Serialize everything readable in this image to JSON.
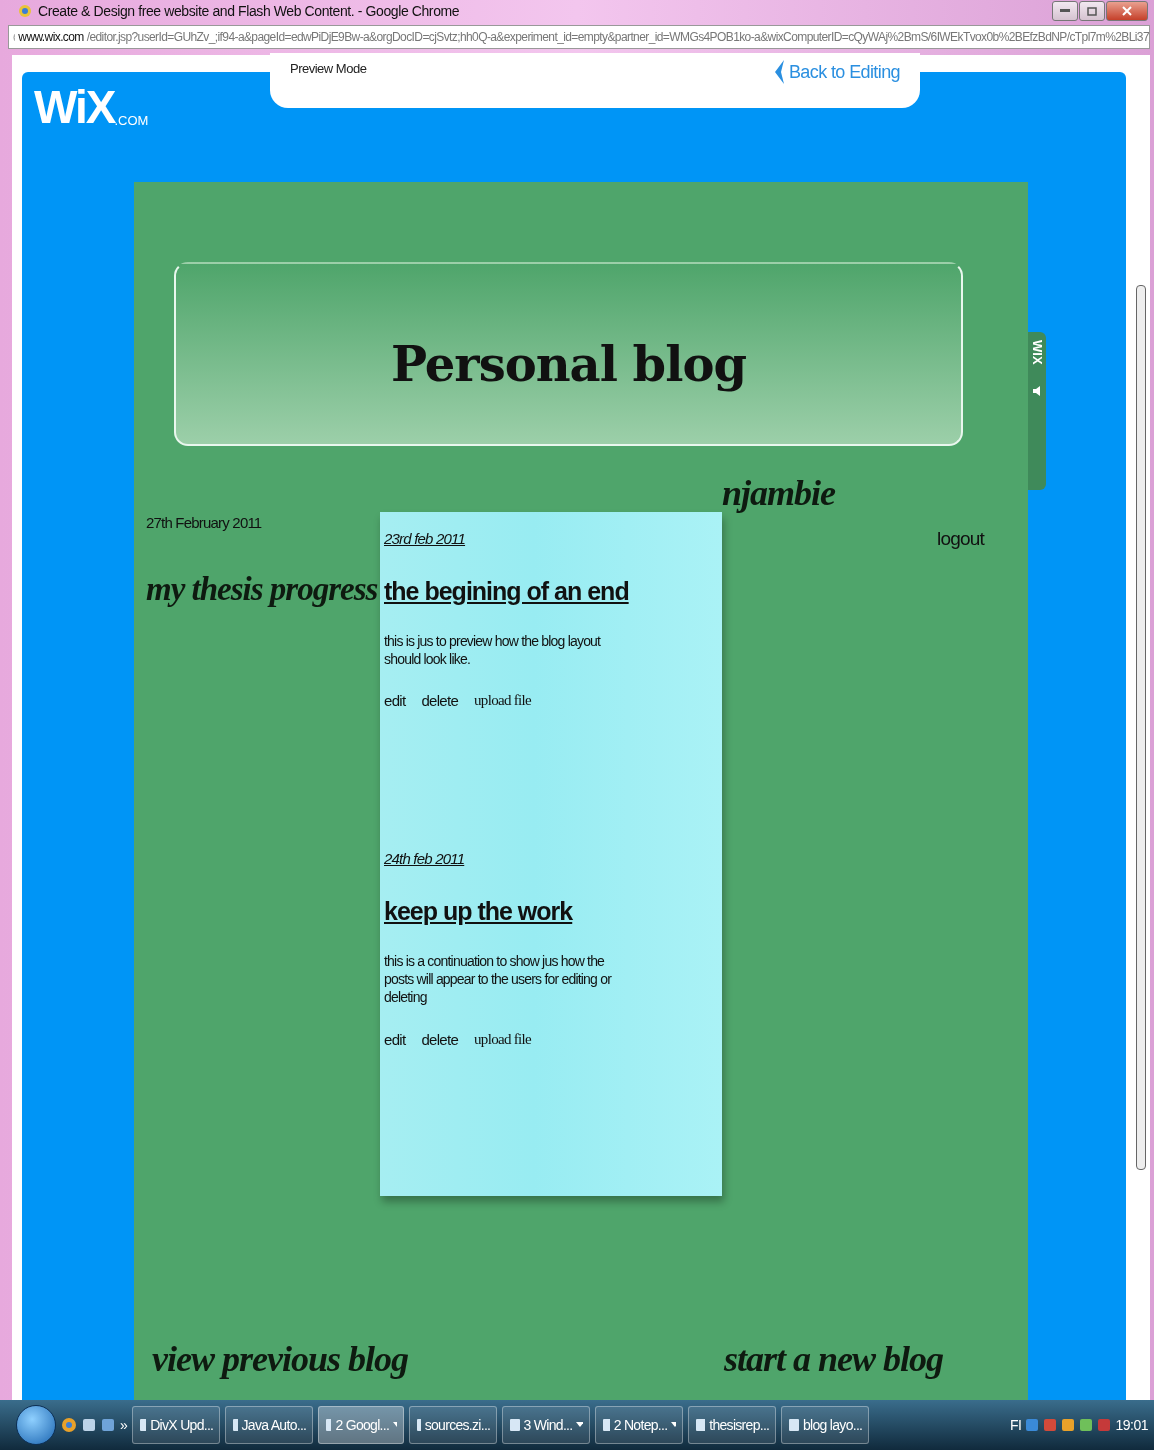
{
  "window": {
    "title": "Create & Design free website and Flash Web Content. - Google Chrome"
  },
  "address_bar": {
    "domain": "www.wix.com",
    "path": "/editor.jsp?userId=GUhZv_;if94-a&pageId=edwPiDjE9Bw-a&orgDocID=cjSvtz;hh0Q-a&experiment_id=empty&partner_id=WMGs4POB1ko-a&wixComputerID=cQyWAj%2BmS/6IWEkTvox0b%2BEfzBdNP/cTpl7m%2BLi37"
  },
  "wix_bar": {
    "logo": "WiX",
    "logo_suffix": ".COM",
    "mode": "Preview Mode",
    "back_link": "Back to Editing"
  },
  "side_tab": {
    "logo": "WIX"
  },
  "blog": {
    "header": "Personal blog",
    "date": "27th February 2011",
    "title": "my thesis progress",
    "user": "njambie",
    "logout": "logout",
    "previous": "view previous blog",
    "new": "start a new blog",
    "posts": [
      {
        "date": "23rd feb 2011",
        "title": "the begining of an end",
        "body": "this is jus to preview how the blog layout should look like.",
        "actions": [
          "edit",
          "delete",
          "upload file"
        ]
      },
      {
        "date": "24th feb 2011",
        "title": "keep up the work",
        "body": "this is a continuation to show jus how the posts will appear to the users for editing or deleting",
        "actions": [
          "edit",
          "delete",
          "upload file"
        ]
      }
    ]
  },
  "taskbar": {
    "chevron": "»",
    "items": [
      {
        "label": "DivX Upd...",
        "grouped": false,
        "selected": false
      },
      {
        "label": "Java Auto...",
        "grouped": false,
        "selected": false
      },
      {
        "label": "2 Googl...",
        "grouped": true,
        "selected": true
      },
      {
        "label": "sources.zi...",
        "grouped": false,
        "selected": false
      },
      {
        "label": "3 Wind...",
        "grouped": true,
        "selected": false
      },
      {
        "label": "2 Notep...",
        "grouped": true,
        "selected": false
      },
      {
        "label": "thesisrep...",
        "grouped": false,
        "selected": false
      },
      {
        "label": "blog layo...",
        "grouped": false,
        "selected": false
      }
    ],
    "language": "FI",
    "clock": "19:01"
  }
}
